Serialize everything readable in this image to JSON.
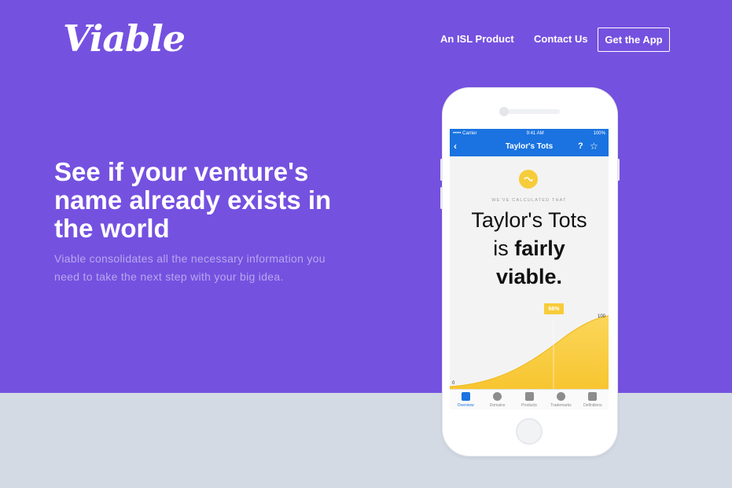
{
  "brand": {
    "logo_text": "Viable"
  },
  "nav": {
    "isl_link": "An ISL Product",
    "contact_link": "Contact Us",
    "cta_button": "Get the App"
  },
  "hero": {
    "headline": "See if your venture's name already exists in the world",
    "subtext": "Viable consolidates all the necessary information you need to take the next step with your big idea."
  },
  "phone": {
    "status": {
      "carrier": "••••• Carrier",
      "time": "9:41 AM",
      "battery": "100%"
    },
    "title": "Taylor's Tots",
    "back_icon": "chevron-left-icon",
    "help_icon": "question-icon",
    "star_icon": "star-icon",
    "kicker": "WE'VE CALCULATED THAT",
    "verdict_line1": "Taylor's Tots",
    "verdict_line2_prefix": "is ",
    "verdict_line2_bold": "fairly",
    "verdict_line3": "viable.",
    "score_label": "66%",
    "axis_min": "0",
    "axis_max": "100",
    "tabs": [
      {
        "label": "Overview",
        "icon": "overview-icon",
        "active": true
      },
      {
        "label": "Domains",
        "icon": "globe-icon",
        "active": false
      },
      {
        "label": "Products",
        "icon": "cart-icon",
        "active": false
      },
      {
        "label": "Trademarks",
        "icon": "trademark-icon",
        "active": false
      },
      {
        "label": "Definitions",
        "icon": "book-icon",
        "active": false
      }
    ]
  },
  "colors": {
    "hero_bg": "#7551e0",
    "lower_bg": "#d3dae4",
    "app_blue": "#1a73e0",
    "accent_yellow": "#f7cc3a"
  }
}
